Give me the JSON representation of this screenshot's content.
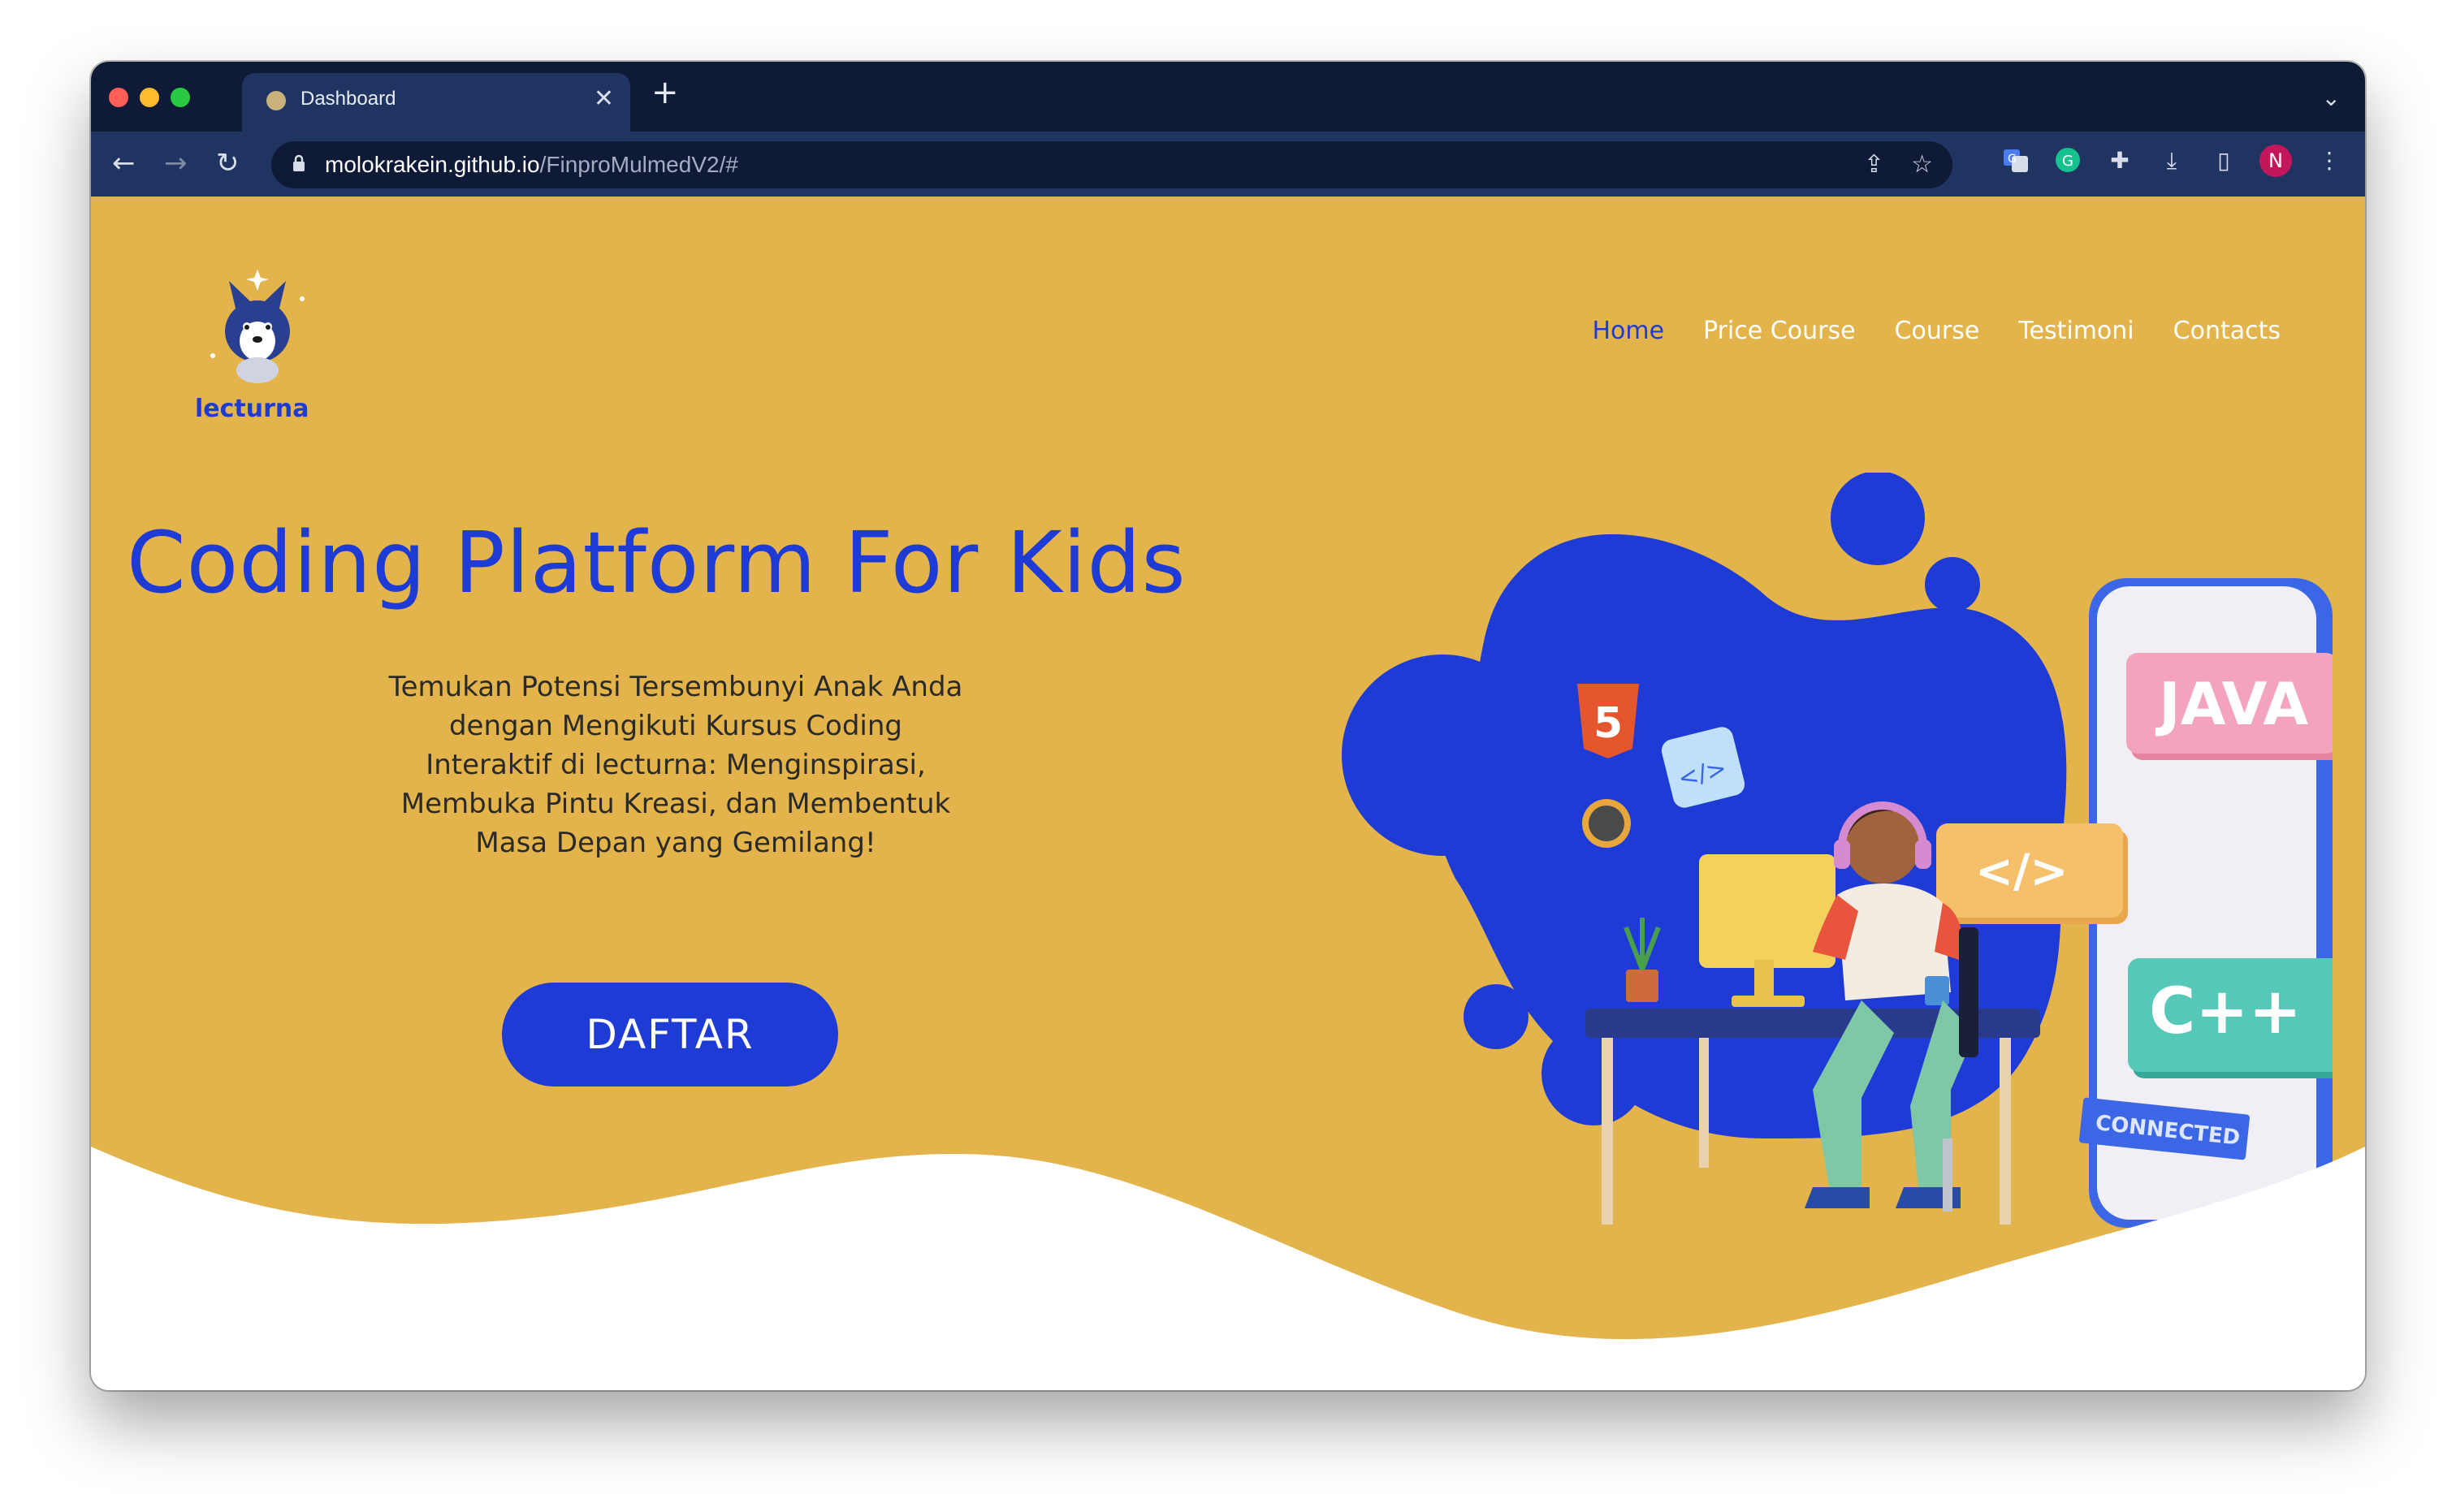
{
  "browser": {
    "tab_title": "Dashboard",
    "tab_close": "✕",
    "new_tab": "+",
    "tab_menu": "⌄",
    "url_host": "molokrakein.github.io",
    "url_path": "/FinproMulmedV2/#",
    "profile_initial": "N",
    "icons": [
      "back-icon",
      "forward-icon",
      "reload-icon",
      "lock-icon",
      "share-icon",
      "star-icon",
      "translate-icon",
      "grammarly-icon",
      "extensions-icon",
      "download-icon",
      "sidepanel-icon",
      "menu-icon"
    ]
  },
  "site": {
    "brand": "lecturna",
    "nav": [
      {
        "label": "Home",
        "active": true
      },
      {
        "label": "Price Course",
        "active": false
      },
      {
        "label": "Course",
        "active": false
      },
      {
        "label": "Testimoni",
        "active": false
      },
      {
        "label": "Contacts",
        "active": false
      }
    ],
    "hero_title": "Coding Platform For Kids",
    "hero_text": "Temukan Potensi Tersembunyi Anak Anda dengan Mengikuti Kursus Coding Interaktif di lecturna: Menginspirasi, Membuka Pintu Kreasi, dan Membentuk Masa Depan yang Gemilang!",
    "cta_label": "DAFTAR"
  },
  "illustration": {
    "card_java": "JAVA",
    "card_code": "</>",
    "card_cpp": "C++",
    "badge_connected": "CONNECTED",
    "html5_label": "5",
    "code_bubble": "</>"
  },
  "colors": {
    "page_bg": "#e3b44b",
    "accent_blue": "#1f3bd6",
    "chrome_dark": "#0f1b36",
    "chrome_tab": "#1f3460"
  }
}
